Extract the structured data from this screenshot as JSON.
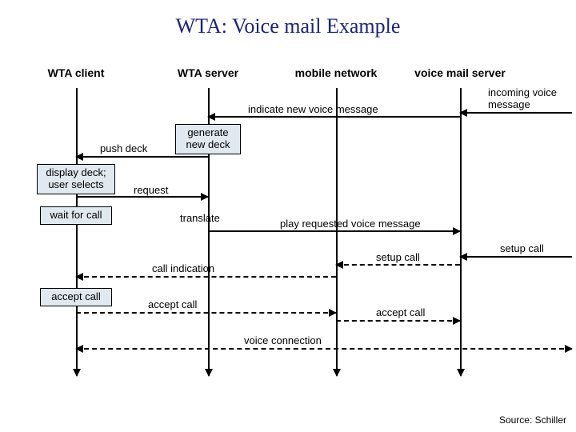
{
  "title": "WTA: Voice mail Example",
  "lanes": {
    "client": "WTA client",
    "server": "WTA server",
    "mobile": "mobile network",
    "voicemail": "voice mail server"
  },
  "boxes": {
    "generate": "generate\nnew deck",
    "display": "display deck;\nuser selects",
    "wait": "wait for call",
    "accept": "accept call"
  },
  "labels": {
    "incoming": "incoming voice\nmessage",
    "indicate": "indicate new voice message",
    "push": "push deck",
    "request": "request",
    "translate": "translate",
    "play": "play requested voice message",
    "setup1": "setup call",
    "setup2": "setup call",
    "callind": "call indication",
    "acceptcall1": "accept call",
    "acceptcall2": "accept call",
    "voiceconn": "voice connection"
  },
  "source": "Source: Schiller"
}
